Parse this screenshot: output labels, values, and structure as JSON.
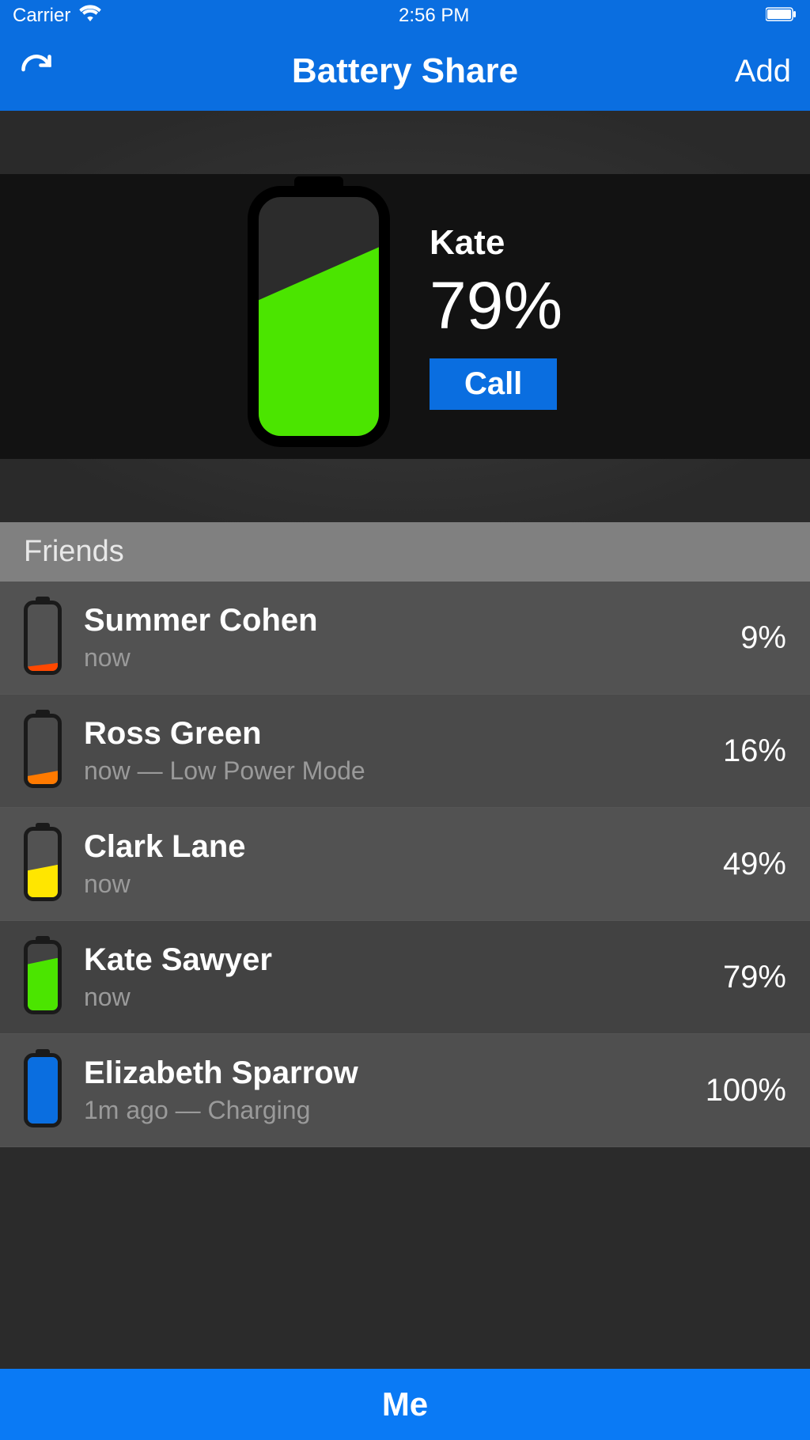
{
  "status_bar": {
    "carrier": "Carrier",
    "time": "2:56 PM"
  },
  "nav": {
    "title": "Battery Share",
    "add_label": "Add"
  },
  "hero": {
    "name": "Kate",
    "percent_label": "79%",
    "percent_value": 79,
    "call_label": "Call"
  },
  "section": {
    "friends_label": "Friends"
  },
  "friends": [
    {
      "name": "Summer Cohen",
      "sub": "now",
      "percent_label": "9%",
      "percent_value": 9,
      "fill_class": "fill-9"
    },
    {
      "name": "Ross Green",
      "sub": "now — Low Power Mode",
      "percent_label": "16%",
      "percent_value": 16,
      "fill_class": "fill-16"
    },
    {
      "name": "Clark Lane",
      "sub": "now",
      "percent_label": "49%",
      "percent_value": 49,
      "fill_class": "fill-49"
    },
    {
      "name": "Kate Sawyer",
      "sub": "now",
      "percent_label": "79%",
      "percent_value": 79,
      "fill_class": "fill-79"
    },
    {
      "name": "Elizabeth Sparrow",
      "sub": "1m ago — Charging",
      "percent_label": "100%",
      "percent_value": 100,
      "fill_class": "fill-100"
    }
  ],
  "tab": {
    "me_label": "Me"
  }
}
